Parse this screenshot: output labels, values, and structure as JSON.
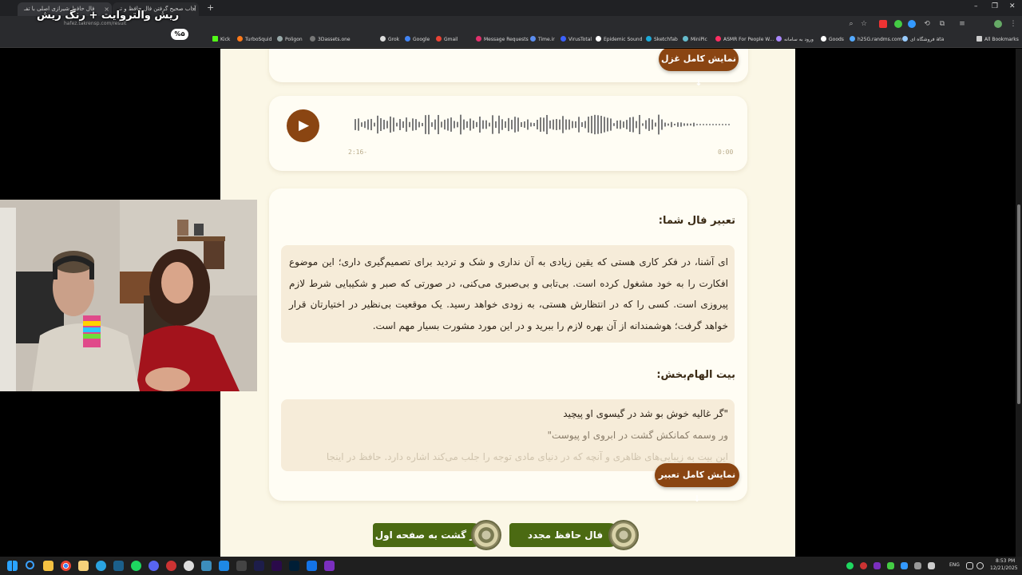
{
  "browser": {
    "tabs": [
      {
        "title": "فال حافظ شیرازی اصلی با تفـ"
      },
      {
        "title": "آداب صحیح گرفتن فال حافظ و تـ"
      },
      {
        "title": "فال حافظ شیرازی اصلی با تـ"
      }
    ],
    "url": "hafez.takrensp.com/result",
    "bookmarks": [
      {
        "label": "Kick",
        "color": "#53fc18"
      },
      {
        "label": "TurboSquid",
        "color": "#ff7a1a"
      },
      {
        "label": "Poligon",
        "color": "#9aa"
      },
      {
        "label": "3Dassets.one",
        "color": "#777"
      },
      {
        "label": "Grok",
        "color": "#ddd"
      },
      {
        "label": "Google",
        "color": "#4285f4"
      },
      {
        "label": "Gmail",
        "color": "#ea4335"
      },
      {
        "label": "Message Requests",
        "color": "#e1306c"
      },
      {
        "label": "Time.ir",
        "color": "#5b8def"
      },
      {
        "label": "VirusTotal",
        "color": "#3b61ff"
      },
      {
        "label": "Epidemic Sound",
        "color": "#fff"
      },
      {
        "label": "Sketchfab",
        "color": "#1caad9"
      },
      {
        "label": "MiniPic",
        "color": "#6bc"
      },
      {
        "label": "ASMR For People W...",
        "color": "#ff2e63"
      },
      {
        "label": "ورود به سامانه",
        "color": "#a8f"
      },
      {
        "label": "Goods",
        "color": "#fff"
      },
      {
        "label": "h25G.randms.com",
        "color": "#5af"
      },
      {
        "label": "فروشگاه ای ata",
        "color": "#9cf"
      },
      {
        "label": "All Bookmarks",
        "color": "#ccc"
      }
    ]
  },
  "overlay": {
    "caption": "ریش والتروایت + رنگ ریش",
    "badge": "%۵"
  },
  "page": {
    "show_full_ghazal_button": "نمایش کامل غزل ↓",
    "audio": {
      "elapsed": "2:16-",
      "position": "0:00"
    },
    "interpretation_heading": "تعبیر فال شما:",
    "interpretation_text": "ای آشنا، در فکر کاری هستی که یقین زیادی به آن نداری و شک و تردید برای تصمیم‌گیری داری؛ این موضوع افکارت را به خود مشغول کرده است. بی‌تابی و بی‌صبری می‌کنی، در صورتی که صبر و شکیبایی شرط لازم پیروزی است. کسی را که در انتظارش هستی، به زودی خواهد رسید. یک موقعیت بی‌نظیر در اختیارتان قرار خواهد گرفت؛ هوشمندانه از آن بهره لازم را ببرید و در این مورد مشورت بسیار مهم است.",
    "verse_heading": "بیت الهام‌بخش:",
    "verse_line_1": "\"گر غالیه خوش بو شد در گیسوی او پیچید",
    "verse_line_2": "ور وسمه کمانکش گشت در ابروی او پیوست\"",
    "verse_line_3": "این بیت به زیبایی‌های ظاهری و آنچه که در دنیای مادی توجه را جلب می‌کند اشاره دارد. حافظ در اینجا",
    "show_full_interpretation_button": "نمایش کامل تعبیر ↓",
    "back_button": "باز گشت به صفحه اول",
    "again_button": "فال حافظ مجدد"
  },
  "taskbar": {
    "lang": "ENG",
    "time": "8:53 PM",
    "date": "12/21/2025"
  },
  "colors": {
    "brown": "#8a4512",
    "green": "#4b6a12",
    "cream": "#fbf7e6"
  }
}
